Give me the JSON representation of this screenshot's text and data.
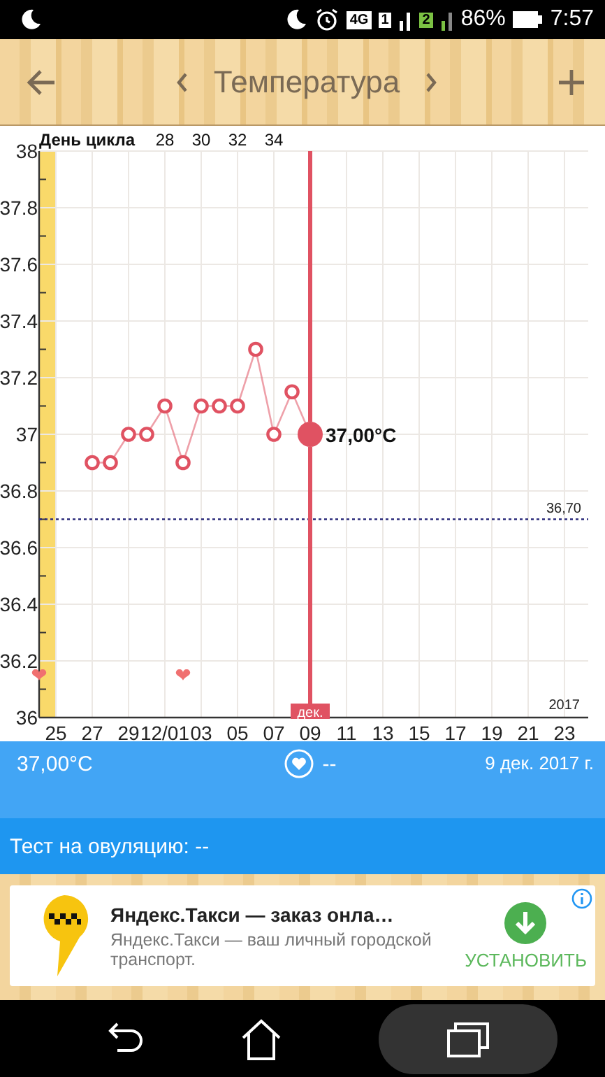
{
  "status_bar": {
    "network": "4G",
    "sim_1": "1",
    "sim_2": "2",
    "battery": "86%",
    "time": "7:57"
  },
  "toolbar": {
    "title": "Температура"
  },
  "chart": {
    "cycle_day_title": "День цикла",
    "cycle_days": [
      "28",
      "30",
      "32",
      "34"
    ],
    "cursor_month": "дек.",
    "year": "2017",
    "chart_data": {
      "type": "line",
      "ylim": [
        36,
        38
      ],
      "yticks": [
        36,
        36.2,
        36.4,
        36.6,
        36.8,
        37,
        37.2,
        37.4,
        37.6,
        37.8,
        38
      ],
      "categories": [
        "25",
        null,
        "27",
        null,
        "29",
        null,
        "12/01",
        null,
        "03",
        null,
        "05",
        null,
        "07",
        null,
        "09",
        null,
        "11",
        null,
        "13",
        null,
        "15",
        null,
        "17",
        null,
        "19",
        null,
        "21",
        null,
        "23"
      ],
      "values": [
        null,
        null,
        36.9,
        36.9,
        37.0,
        37.0,
        37.1,
        36.9,
        37.1,
        37.1,
        37.1,
        37.3,
        37.0,
        37.15,
        37.0,
        null,
        null,
        null,
        null,
        null,
        null,
        null,
        null,
        null,
        null,
        null,
        null,
        null,
        null
      ],
      "grid": true,
      "marker": "o",
      "ref_lines": [
        {
          "axis": "y",
          "value": 36.7,
          "label": "36,70"
        }
      ],
      "annotations": [
        {
          "x": "09",
          "y": 37,
          "text": "37,00°C"
        },
        {
          "text": "❤"
        },
        {
          "text": "❤"
        }
      ]
    }
  },
  "day_info": {
    "temperature": "37,00°C",
    "intercourse": "--",
    "date": "9 дек. 2017 г."
  },
  "ovulation_test": {
    "label": "Тест на овуляцию: --"
  },
  "ad": {
    "title": "Яндекс.Такси — заказ онла…",
    "description": "Яндекс.Такси — ваш личный городской транспорт.",
    "button": "УСТАНОВИТЬ"
  }
}
